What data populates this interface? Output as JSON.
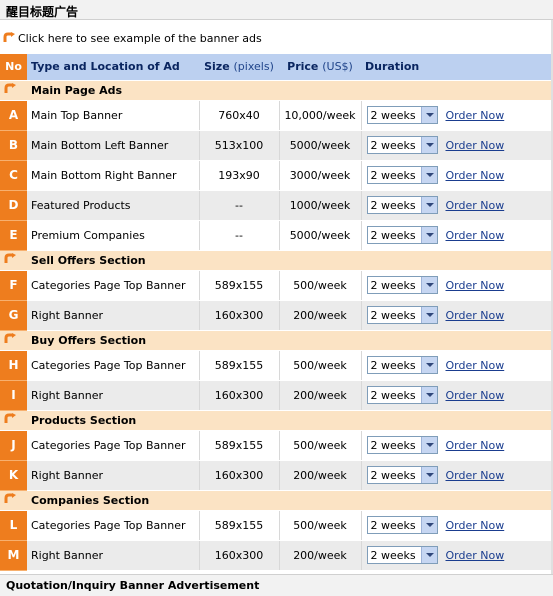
{
  "page_title": "醒目标题广告",
  "example_link": "Click here to see example of the banner ads",
  "header": {
    "no": "No",
    "type": "Type and Location of Ad",
    "size": "Size",
    "size_unit": "(pixels)",
    "price": "Price",
    "price_unit": "(US$)",
    "duration": "Duration"
  },
  "order_label": "Order Now",
  "duration_value": "2 weeks",
  "sections": [
    {
      "title": "Main Page Ads",
      "rows": [
        {
          "no": "A",
          "type": "Main Top Banner",
          "size": "760x40",
          "price": "10,000/week"
        },
        {
          "no": "B",
          "type": "Main Bottom Left Banner",
          "size": "513x100",
          "price": "5000/week"
        },
        {
          "no": "C",
          "type": "Main Bottom Right Banner",
          "size": "193x90",
          "price": "3000/week"
        },
        {
          "no": "D",
          "type": "Featured Products",
          "size": "--",
          "price": "1000/week"
        },
        {
          "no": "E",
          "type": "Premium Companies",
          "size": "--",
          "price": "5000/week"
        }
      ]
    },
    {
      "title": "Sell Offers Section",
      "rows": [
        {
          "no": "F",
          "type": "Categories Page Top Banner",
          "size": "589x155",
          "price": "500/week"
        },
        {
          "no": "G",
          "type": "Right Banner",
          "size": "160x300",
          "price": "200/week"
        }
      ]
    },
    {
      "title": "Buy Offers Section",
      "rows": [
        {
          "no": "H",
          "type": "Categories Page Top Banner",
          "size": "589x155",
          "price": "500/week"
        },
        {
          "no": "I",
          "type": "Right Banner",
          "size": "160x300",
          "price": "200/week"
        }
      ]
    },
    {
      "title": "Products Section",
      "rows": [
        {
          "no": "J",
          "type": "Categories Page Top Banner",
          "size": "589x155",
          "price": "500/week"
        },
        {
          "no": "K",
          "type": "Right Banner",
          "size": "160x300",
          "price": "200/week"
        }
      ]
    },
    {
      "title": "Companies Section",
      "rows": [
        {
          "no": "L",
          "type": "Categories Page Top Banner",
          "size": "589x155",
          "price": "500/week"
        },
        {
          "no": "M",
          "type": "Right Banner",
          "size": "160x300",
          "price": "200/week"
        }
      ]
    }
  ],
  "footer_title": "Quotation/Inquiry Banner Advertisement",
  "colors": {
    "accent": "#ee7d1e",
    "header_bg": "#bcd0f0",
    "section_bg": "#fbe3c4",
    "link": "#1a3d8f"
  }
}
